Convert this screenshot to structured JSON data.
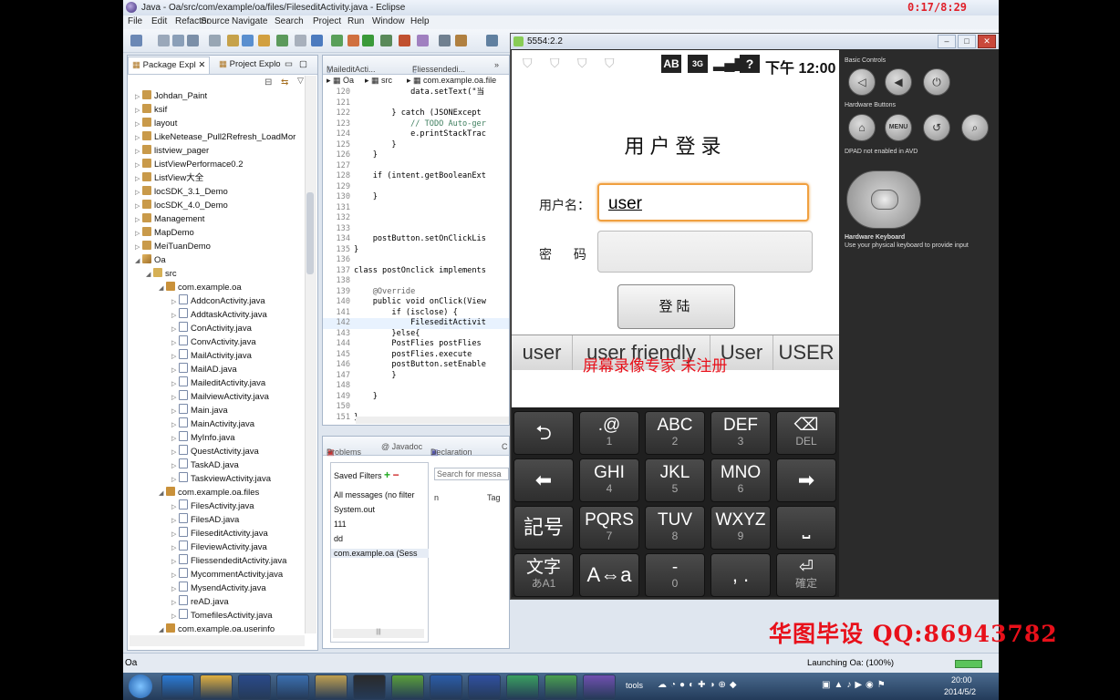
{
  "recorder": {
    "timer": "0:17/8:29",
    "watermark": "华图毕设 QQ:86943782",
    "overlay": "屏幕录像专家 未注册"
  },
  "eclipse": {
    "title": "Java - Oa/src/com/example/oa/files/FileseditActivity.java - Eclipse",
    "menu": [
      "File",
      "Edit",
      "Refactor",
      "Source",
      "Navigate",
      "Search",
      "Project",
      "Run",
      "Window",
      "Help"
    ],
    "explorer_tabs": [
      "Package Expl",
      "Project Explo"
    ],
    "tree": [
      {
        "label": "Johdan_Paint",
        "depth": 1,
        "type": "proj"
      },
      {
        "label": "ksif",
        "depth": 1,
        "type": "proj"
      },
      {
        "label": "layout",
        "depth": 1,
        "type": "proj"
      },
      {
        "label": "LikeNetease_Pull2Refresh_LoadMor",
        "depth": 1,
        "type": "proj"
      },
      {
        "label": "listview_pager",
        "depth": 1,
        "type": "proj"
      },
      {
        "label": "ListViewPerformace0.2",
        "depth": 1,
        "type": "proj"
      },
      {
        "label": "ListView大全",
        "depth": 1,
        "type": "proj"
      },
      {
        "label": "locSDK_3.1_Demo",
        "depth": 1,
        "type": "proj"
      },
      {
        "label": "locSDK_4.0_Demo",
        "depth": 1,
        "type": "proj"
      },
      {
        "label": "Management",
        "depth": 1,
        "type": "proj"
      },
      {
        "label": "MapDemo",
        "depth": 1,
        "type": "proj"
      },
      {
        "label": "MeiTuanDemo",
        "depth": 1,
        "type": "proj"
      },
      {
        "label": "Oa",
        "depth": 1,
        "type": "jproj",
        "open": true
      },
      {
        "label": "src",
        "depth": 2,
        "type": "src",
        "open": true
      },
      {
        "label": "com.example.oa",
        "depth": 3,
        "type": "pkgi",
        "open": true
      },
      {
        "label": "AddconActivity.java",
        "depth": 4,
        "type": "java"
      },
      {
        "label": "AddtaskActivity.java",
        "depth": 4,
        "type": "java"
      },
      {
        "label": "ConActivity.java",
        "depth": 4,
        "type": "java"
      },
      {
        "label": "ConvActivity.java",
        "depth": 4,
        "type": "java"
      },
      {
        "label": "MailActivity.java",
        "depth": 4,
        "type": "java"
      },
      {
        "label": "MailAD.java",
        "depth": 4,
        "type": "java"
      },
      {
        "label": "MaileditActivity.java",
        "depth": 4,
        "type": "java"
      },
      {
        "label": "MailviewActivity.java",
        "depth": 4,
        "type": "java"
      },
      {
        "label": "Main.java",
        "depth": 4,
        "type": "java"
      },
      {
        "label": "MainActivity.java",
        "depth": 4,
        "type": "java"
      },
      {
        "label": "MyInfo.java",
        "depth": 4,
        "type": "java"
      },
      {
        "label": "QuestActivity.java",
        "depth": 4,
        "type": "java"
      },
      {
        "label": "TaskAD.java",
        "depth": 4,
        "type": "java"
      },
      {
        "label": "TaskviewActivity.java",
        "depth": 4,
        "type": "java"
      },
      {
        "label": "com.example.oa.files",
        "depth": 3,
        "type": "pkgi",
        "open": true
      },
      {
        "label": "FilesActivity.java",
        "depth": 4,
        "type": "java"
      },
      {
        "label": "FilesAD.java",
        "depth": 4,
        "type": "java"
      },
      {
        "label": "FileseditActivity.java",
        "depth": 4,
        "type": "java"
      },
      {
        "label": "FileviewActivity.java",
        "depth": 4,
        "type": "java"
      },
      {
        "label": "FliessendeditActivity.java",
        "depth": 4,
        "type": "java"
      },
      {
        "label": "MycommentActivity.java",
        "depth": 4,
        "type": "java"
      },
      {
        "label": "MysendActivity.java",
        "depth": 4,
        "type": "java"
      },
      {
        "label": "reAD.java",
        "depth": 4,
        "type": "java"
      },
      {
        "label": "TomefilesActivity.java",
        "depth": 4,
        "type": "java"
      },
      {
        "label": "com.example.oa.userinfo",
        "depth": 3,
        "type": "pkgi",
        "open": true
      }
    ],
    "editor_tabs": [
      "MaileditActi...",
      "Fliessendedi..."
    ],
    "breadcrumb": [
      "Oa",
      "src",
      "com.example.oa.file"
    ],
    "code": [
      {
        "n": "120",
        "t": "            data.setText(\"当"
      },
      {
        "n": "121",
        "t": ""
      },
      {
        "n": "122",
        "t": "        } catch (JSONExcept"
      },
      {
        "n": "123",
        "t": "            // TODO Auto-ger"
      },
      {
        "n": "124",
        "t": "            e.printStackTrac"
      },
      {
        "n": "125",
        "t": "        }"
      },
      {
        "n": "126",
        "t": "    }"
      },
      {
        "n": "127",
        "t": ""
      },
      {
        "n": "128",
        "t": "    if (intent.getBooleanExt"
      },
      {
        "n": "129",
        "t": ""
      },
      {
        "n": "130",
        "t": "    }"
      },
      {
        "n": "131",
        "t": ""
      },
      {
        "n": "132",
        "t": ""
      },
      {
        "n": "133",
        "t": ""
      },
      {
        "n": "134",
        "t": "    postButton.setOnClickLis"
      },
      {
        "n": "135",
        "t": "}"
      },
      {
        "n": "136",
        "t": ""
      },
      {
        "n": "137",
        "t": "class postOnclick implements"
      },
      {
        "n": "138",
        "t": ""
      },
      {
        "n": "139",
        "t": "    @Override"
      },
      {
        "n": "140",
        "t": "    public void onClick(View"
      },
      {
        "n": "141",
        "t": "        if (isclose) {"
      },
      {
        "n": "142",
        "t": "            FileseditActivit"
      },
      {
        "n": "143",
        "t": "        }else{"
      },
      {
        "n": "144",
        "t": "        PostFlies postFlies"
      },
      {
        "n": "145",
        "t": "        postFlies.execute"
      },
      {
        "n": "146",
        "t": "        postButton.setEnable"
      },
      {
        "n": "147",
        "t": "        }"
      },
      {
        "n": "148",
        "t": ""
      },
      {
        "n": "149",
        "t": "    }"
      },
      {
        "n": "150",
        "t": ""
      },
      {
        "n": "151",
        "t": "}"
      }
    ],
    "console_tabs": [
      "Problems",
      "@ Javadoc",
      "Declaration",
      "C"
    ],
    "saved_filters_label": "Saved Filters",
    "filters": [
      "All messages (no filter",
      "System.out",
      "111",
      "dd",
      "com.example.oa (Sess"
    ],
    "log_search_placeholder": "Search for messa",
    "log_cols": [
      "n",
      "Tag"
    ],
    "status_left": "Oa",
    "status_right": "Launching Oa: (100%)"
  },
  "emulator": {
    "title": "5554:2.2",
    "clock": "下午 12:00",
    "screen_title": "用户登录",
    "username_label": "用户名：",
    "password_label": "密 码：",
    "username_value": "user",
    "login_button": "登陆",
    "suggestions": [
      "user",
      "user friendly",
      "User",
      "USER"
    ],
    "keys": [
      {
        "main": "⮌",
        "sub": "",
        "icon": true
      },
      {
        "main": ".@",
        "sub": "1"
      },
      {
        "main": "ABC",
        "sub": "2"
      },
      {
        "main": "DEF",
        "sub": "3"
      },
      {
        "main": "⌫",
        "sub": "DEL"
      },
      {
        "main": "⬅",
        "sub": "",
        "icon": true
      },
      {
        "main": "GHI",
        "sub": "4"
      },
      {
        "main": "JKL",
        "sub": "5"
      },
      {
        "main": "MNO",
        "sub": "6"
      },
      {
        "main": "➡",
        "sub": "",
        "icon": true
      },
      {
        "main": "記号",
        "sub": "",
        "icon": true
      },
      {
        "main": "PQRS",
        "sub": "7"
      },
      {
        "main": "TUV",
        "sub": "8"
      },
      {
        "main": "WXYZ",
        "sub": "9"
      },
      {
        "main": "⎵",
        "sub": "",
        "icon": true
      },
      {
        "main": "文字",
        "sub": "あA1"
      },
      {
        "main": "A⇔a",
        "sub": "",
        "icon": true
      },
      {
        "main": "-",
        "sub": "0"
      },
      {
        "main": ", .",
        "sub": "",
        "icon": true
      },
      {
        "main": "⏎",
        "sub": "確定"
      }
    ],
    "controls": {
      "basic_label": "Basic Controls",
      "hardware_label": "Hardware Buttons",
      "dpad_label": "DPAD not enabled in AVD",
      "kbd_label": "Hardware Keyboard",
      "kbd_hint": "Use your physical keyboard to provide input",
      "menu_label": "MENU"
    }
  },
  "taskbar": {
    "tools_label": "tools",
    "time": "20:00",
    "date": "2014/5/2"
  }
}
